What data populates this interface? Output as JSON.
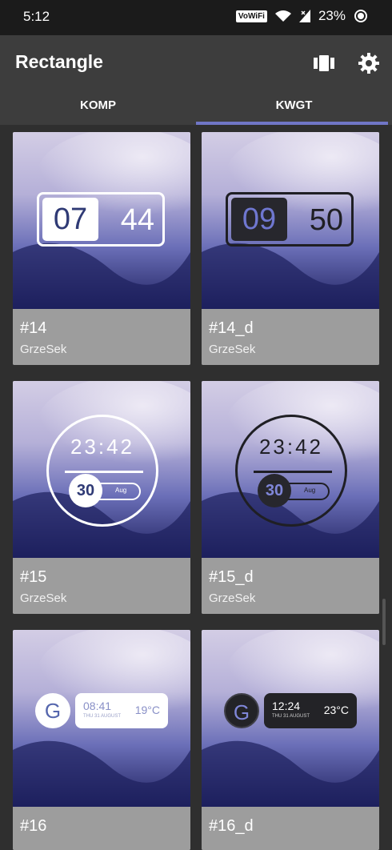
{
  "status_bar": {
    "time": "5:12",
    "network_label": "VoWiFi",
    "battery": "23%"
  },
  "app_bar": {
    "title": "Rectangle",
    "icons": [
      "carousel-icon",
      "gear-icon"
    ]
  },
  "tabs": [
    {
      "label": "KOMP",
      "active": false
    },
    {
      "label": "KWGT",
      "active": true
    }
  ],
  "cards": [
    {
      "name": "#14",
      "author": "GrzeSek",
      "widget": {
        "type": "rectangle-clock",
        "theme": "light",
        "hour": "07",
        "minute": "44"
      }
    },
    {
      "name": "#14_d",
      "author": "GrzeSek",
      "widget": {
        "type": "rectangle-clock",
        "theme": "dark",
        "hour": "09",
        "minute": "50"
      }
    },
    {
      "name": "#15",
      "author": "GrzeSek",
      "widget": {
        "type": "round-clock",
        "theme": "light",
        "time": "23:42",
        "day": "30",
        "month": "Aug"
      }
    },
    {
      "name": "#15_d",
      "author": "GrzeSek",
      "widget": {
        "type": "round-clock",
        "theme": "dark",
        "time": "23:42",
        "day": "30",
        "month": "Aug"
      }
    },
    {
      "name": "#16",
      "author": "",
      "widget": {
        "type": "google-pill",
        "theme": "light",
        "letter": "G",
        "time": "08:41",
        "date": "THU 31 AUGUST",
        "temp": "19°C"
      }
    },
    {
      "name": "#16_d",
      "author": "",
      "widget": {
        "type": "google-pill",
        "theme": "dark",
        "letter": "G",
        "time": "12:24",
        "date": "THU 31 AUGUST",
        "temp": "23°C"
      }
    }
  ],
  "colors": {
    "accent": "#7076c6",
    "card_caption": "#9d9d9d",
    "wallpaper_light": "#d7d3e8",
    "wallpaper_dark": "#3e3f91"
  }
}
